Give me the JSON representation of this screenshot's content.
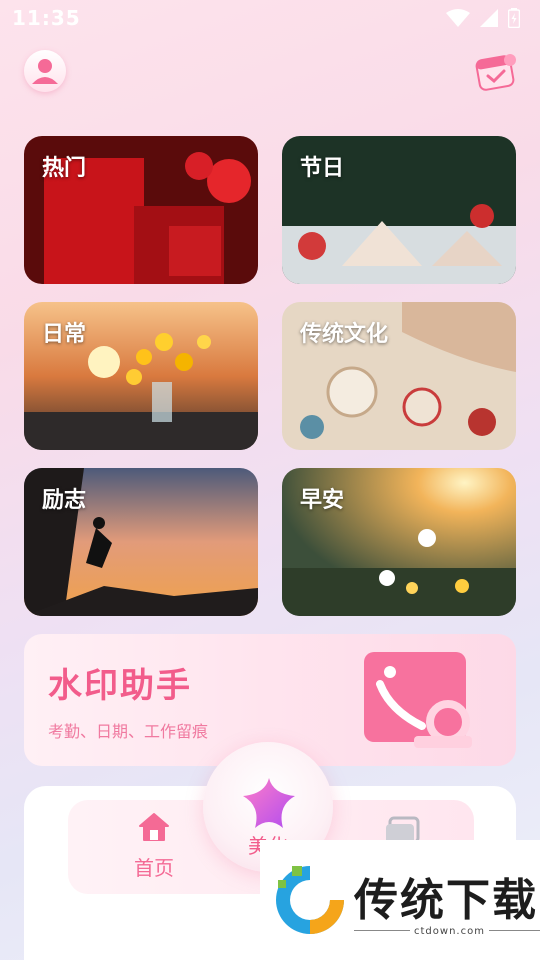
{
  "status": {
    "time": "11:35"
  },
  "categories": [
    {
      "label": "热门"
    },
    {
      "label": "节日"
    },
    {
      "label": "日常"
    },
    {
      "label": "传统文化"
    },
    {
      "label": "励志"
    },
    {
      "label": "早安"
    }
  ],
  "banner": {
    "title": "水印助手",
    "subtitle": "考勤、日期、工作留痕"
  },
  "tabs": {
    "home": "首页",
    "center": "美化"
  },
  "watermark": {
    "brand": "传统下载",
    "url": "ctdown.com"
  },
  "colors": {
    "accent": "#f25c8b",
    "tab_active": "#f46a95"
  }
}
